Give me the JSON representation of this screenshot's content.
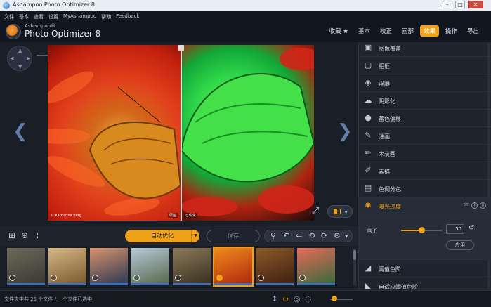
{
  "window": {
    "title": "Ashampoo Photo Optimizer 8",
    "min": "–",
    "max": "□",
    "close": "✕"
  },
  "menu": [
    "文件",
    "基本",
    "查看",
    "设置",
    "MyAshampoo",
    "帮助",
    "Feedback"
  ],
  "logo": {
    "brand": "Ashampoo®",
    "product": "Photo Optimizer 8"
  },
  "topnav": [
    {
      "label": "收藏 ★",
      "active": false
    },
    {
      "label": "基本",
      "active": false
    },
    {
      "label": "校正",
      "active": false
    },
    {
      "label": "画部",
      "active": false
    },
    {
      "label": "效果",
      "active": true
    },
    {
      "label": "操作",
      "active": false
    },
    {
      "label": "导出",
      "active": false
    }
  ],
  "viewer": {
    "left_caption": "© Katharina Berg",
    "left_tag": "原始",
    "right_tag": "已优化"
  },
  "toolbar": {
    "auto_label": "自动优化",
    "save_label": "保存"
  },
  "thumbnails": [
    {
      "colors": [
        "#6b6a5c",
        "#3c3a30"
      ],
      "selected": false
    },
    {
      "colors": [
        "#d6b785",
        "#7c5a30"
      ],
      "selected": false
    },
    {
      "colors": [
        "#d8936a",
        "#2f3a55"
      ],
      "selected": false
    },
    {
      "colors": [
        "#b7c8d6",
        "#5a6a50"
      ],
      "selected": false
    },
    {
      "colors": [
        "#8c7a5a",
        "#3a3020"
      ],
      "selected": false
    },
    {
      "colors": [
        "#f08a1c",
        "#b02a0e"
      ],
      "selected": true
    },
    {
      "colors": [
        "#8c5a2a",
        "#402010"
      ],
      "selected": false
    },
    {
      "colors": [
        "#e86a5a",
        "#3a6a3a"
      ],
      "selected": false
    }
  ],
  "status": {
    "text": "文件夹中共 25 个文件 / 一个文件已选中"
  },
  "panel": {
    "items": [
      {
        "icon": "image-overlay-icon",
        "glyph": "▣",
        "label": "图像覆盖"
      },
      {
        "icon": "frame-icon",
        "glyph": "▢",
        "label": "相框"
      },
      {
        "icon": "emboss-icon",
        "glyph": "◈",
        "label": "浮雕"
      },
      {
        "icon": "shadow-icon",
        "glyph": "☁",
        "label": "阴影化"
      },
      {
        "icon": "blue-shift-icon",
        "glyph": "●",
        "label": "蓝色偏移"
      },
      {
        "icon": "oil-paint-icon",
        "glyph": "✎",
        "label": "油画"
      },
      {
        "icon": "charcoal-icon",
        "glyph": "✏",
        "label": "木炭画"
      },
      {
        "icon": "sketch-icon",
        "glyph": "✐",
        "label": "素描"
      },
      {
        "icon": "posterize-icon",
        "glyph": "▤",
        "label": "色调分色"
      },
      {
        "icon": "solarize-icon",
        "glyph": "✺",
        "label": "曝光过度",
        "active": true
      },
      {
        "icon": "threshold-icon",
        "glyph": "◢",
        "label": "阈值色阶"
      },
      {
        "icon": "adaptive-threshold-icon",
        "glyph": "◣",
        "label": "自适应阈值色阶"
      }
    ],
    "settings": {
      "param_label": "阈子",
      "value": 50,
      "apply_label": "应用"
    }
  }
}
